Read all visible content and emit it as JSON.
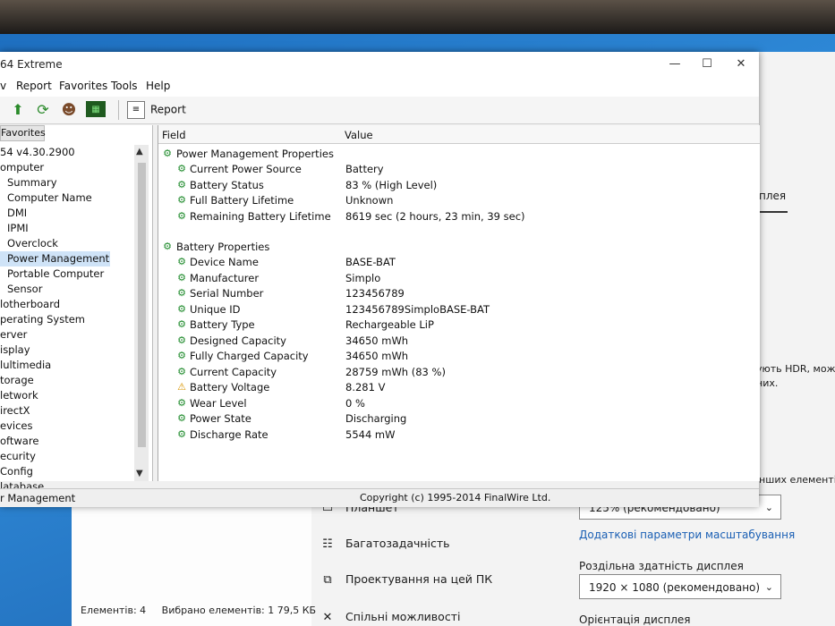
{
  "app": {
    "title": "64 Extreme",
    "window_controls": [
      "—",
      "☐",
      "✕"
    ]
  },
  "menu": [
    "v",
    "Report",
    "Favorites",
    "Tools",
    "Help"
  ],
  "toolbar": {
    "icons": [
      "up-arrow-icon",
      "refresh-icon",
      "users-icon",
      "motherboard-icon"
    ],
    "report_label": "Report"
  },
  "tree": {
    "header": "Favorites",
    "items": [
      "54 v4.30.2900",
      "omputer",
      "Summary",
      "Computer Name",
      "DMI",
      "IPMI",
      "Overclock",
      "Power Management",
      "Portable Computer",
      "Sensor",
      "lotherboard",
      "perating System",
      "erver",
      "isplay",
      "lultimedia",
      "torage",
      "letwork",
      "irectX",
      "evices",
      "oftware",
      "ecurity",
      "Config",
      "latabase"
    ],
    "selected": "Power Management"
  },
  "panel": {
    "field_header": "Field",
    "value_header": "Value",
    "sections": [
      {
        "title": "Power Management Properties",
        "rows": [
          {
            "field": "Current Power Source",
            "value": "Battery"
          },
          {
            "field": "Battery Status",
            "value": "83 % (High Level)"
          },
          {
            "field": "Full Battery Lifetime",
            "value": "Unknown"
          },
          {
            "field": "Remaining Battery Lifetime",
            "value": "8619 sec (2 hours, 23 min, 39 sec)"
          }
        ]
      },
      {
        "title": "Battery Properties",
        "rows": [
          {
            "field": "Device Name",
            "value": "BASE-BAT"
          },
          {
            "field": "Manufacturer",
            "value": "Simplo"
          },
          {
            "field": "Serial Number",
            "value": "123456789"
          },
          {
            "field": "Unique ID",
            "value": "123456789SimploBASE-BAT"
          },
          {
            "field": "Battery Type",
            "value": "Rechargeable LiP"
          },
          {
            "field": "Designed Capacity",
            "value": "34650 mWh"
          },
          {
            "field": "Fully Charged Capacity",
            "value": "34650 mWh"
          },
          {
            "field": "Current Capacity",
            "value": "28759 mWh  (83 %)"
          },
          {
            "field": "Battery Voltage",
            "value": "8.281 V",
            "warning": true
          },
          {
            "field": "Wear Level",
            "value": "0 %"
          },
          {
            "field": "Power State",
            "value": "Discharging"
          },
          {
            "field": "Discharge Rate",
            "value": "5544 mW"
          }
        ]
      }
    ]
  },
  "status": {
    "left": "r Management",
    "copyright": "Copyright (c) 1995-2014 FinalWire Ltd."
  },
  "settings": {
    "fragments": [
      "плея",
      "ують HDR, можна",
      "них.",
      "інших елементів"
    ],
    "menu_items": [
      {
        "icon": "tablet-icon",
        "label": "Планшет"
      },
      {
        "icon": "multitasking-icon",
        "label": "Багатозадачність"
      },
      {
        "icon": "project-icon",
        "label": "Проектування на цей ПК"
      },
      {
        "icon": "shared-icon",
        "label": "Спільні можливості"
      }
    ],
    "scale_value": "125% (рекомендовано)",
    "advanced_link": "Додаткові параметри масштабування",
    "resolution_label": "Роздільна здатність дисплея",
    "resolution_value": "1920 × 1080 (рекомендовано)",
    "orientation_label": "Орієнтація дисплея"
  },
  "explorer": {
    "items_count": "Елементів: 4",
    "selected_info": "Вибрано елементів: 1  79,5 КБ"
  }
}
